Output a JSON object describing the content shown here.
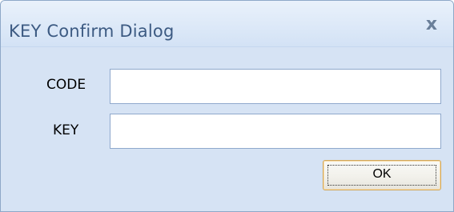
{
  "window": {
    "title": "KEY Confirm Dialog",
    "close_icon": "close-icon",
    "close_glyph": "x"
  },
  "form": {
    "code_label": "CODE",
    "code_value": "",
    "key_label": "KEY",
    "key_value": "",
    "ok_label": "OK"
  },
  "colors": {
    "background": "#d6e3f4",
    "title_text": "#3c5a82",
    "button_border": "#d2a75a"
  }
}
